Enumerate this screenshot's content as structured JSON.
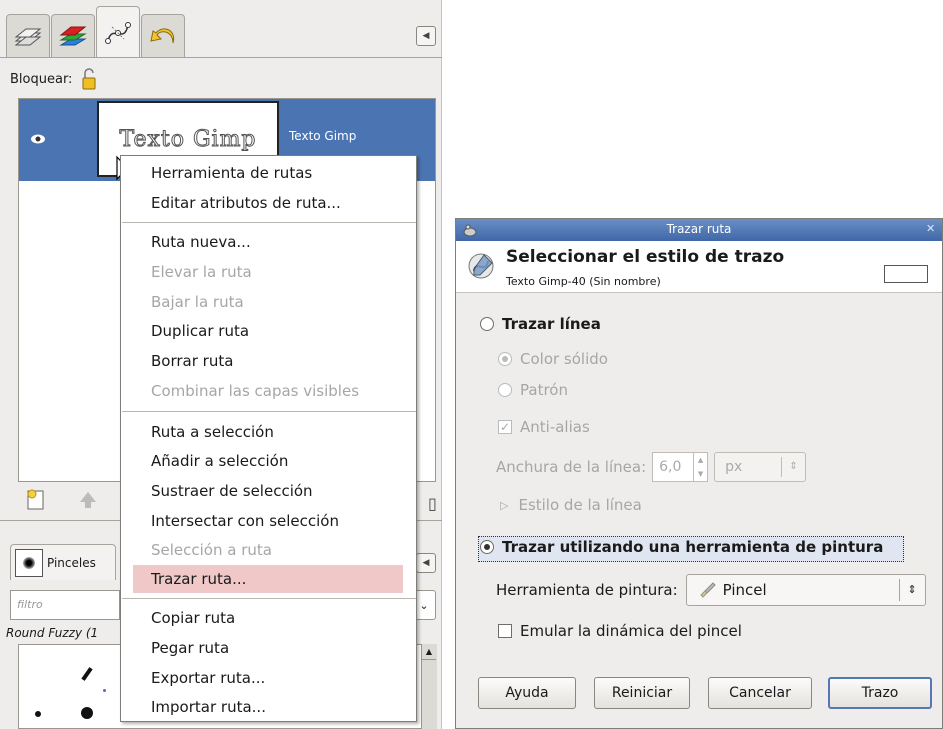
{
  "dock": {
    "tabs": [
      "layers-icon",
      "channels-icon",
      "paths-icon",
      "undo-history-icon"
    ],
    "lock_label": "Bloquear:",
    "path": {
      "thumbnail_text": "Texto Gimp",
      "name": "Texto Gimp"
    },
    "brushes": {
      "tab_label": "Pinceles",
      "filter_placeholder": "filtro",
      "brush_name": "Round Fuzzy (1"
    }
  },
  "context_menu": {
    "items": [
      {
        "label": "Herramienta de rutas",
        "enabled": true
      },
      {
        "label": "Editar atributos de ruta...",
        "enabled": true
      },
      {
        "label": "Ruta nueva...",
        "enabled": true
      },
      {
        "label": "Elevar la ruta",
        "enabled": false
      },
      {
        "label": "Bajar la ruta",
        "enabled": false
      },
      {
        "label": "Duplicar ruta",
        "enabled": true
      },
      {
        "label": "Borrar ruta",
        "enabled": true
      },
      {
        "label": "Combinar las capas visibles",
        "enabled": false
      },
      {
        "label": "Ruta a selección",
        "enabled": true
      },
      {
        "label": "Añadir a selección",
        "enabled": true
      },
      {
        "label": "Sustraer de selección",
        "enabled": true
      },
      {
        "label": "Intersectar con selección",
        "enabled": true
      },
      {
        "label": "Selección a ruta",
        "enabled": false
      },
      {
        "label": "Trazar ruta...",
        "enabled": true,
        "highlighted": true
      },
      {
        "label": "Copiar ruta",
        "enabled": true
      },
      {
        "label": "Pegar ruta",
        "enabled": true
      },
      {
        "label": "Exportar ruta...",
        "enabled": true
      },
      {
        "label": "Importar ruta...",
        "enabled": true
      }
    ]
  },
  "dialog": {
    "title": "Trazar ruta",
    "header_title": "Seleccionar el estilo de trazo",
    "header_subtitle": "Texto Gimp-40 (Sin nombre)",
    "stroke_line_label": "Trazar línea",
    "solid_color_label": "Color sólido",
    "pattern_label": "Patrón",
    "antialias_label": "Anti-alias",
    "line_width_label": "Anchura de la línea:",
    "line_width_value": "6,0",
    "line_width_unit": "px",
    "line_style_label": "Estilo de la línea",
    "paint_tool_option_label": "Trazar utilizando una herramienta de pintura",
    "paint_tool_label": "Herramienta de pintura:",
    "paint_tool_value": "Pincel",
    "emulate_dynamics_label": "Emular la dinámica del pincel",
    "buttons": {
      "help": "Ayuda",
      "reset": "Reiniciar",
      "cancel": "Cancelar",
      "stroke": "Trazo"
    }
  },
  "colors": {
    "selection_blue": "#4a74b2",
    "menu_highlight": "#f0c8c8",
    "titlebar": "#4a72b0"
  }
}
